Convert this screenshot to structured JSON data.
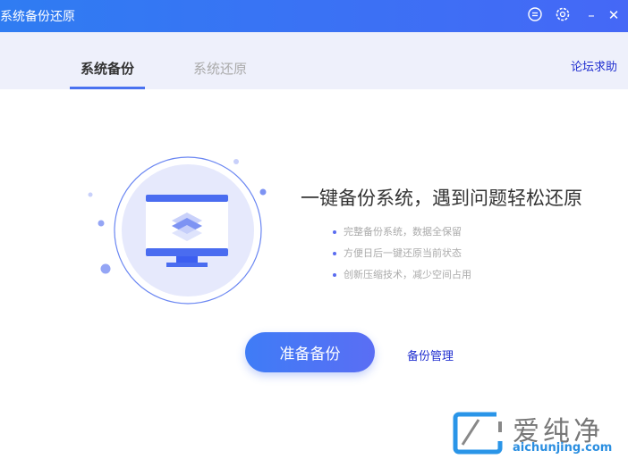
{
  "window": {
    "title": "系统备份还原",
    "icons": [
      "feedback-icon",
      "settings-icon",
      "minimize-icon",
      "close-icon"
    ],
    "accent": "#4568f6"
  },
  "nav": {
    "tabs": [
      {
        "label": "系统备份",
        "active": true
      },
      {
        "label": "系统还原",
        "active": false
      }
    ],
    "forum_link": "论坛求助"
  },
  "main": {
    "headline": "一键备份系统，遇到问题轻松还原",
    "features": [
      "完整备份系统，数据全保留",
      "方便日后一键还原当前状态",
      "创新压缩技术，减少空间占用"
    ],
    "primary_button": "准备备份",
    "manage_link": "备份管理"
  },
  "watermark": {
    "text": "爱纯净",
    "url": "aichunjing.com"
  }
}
